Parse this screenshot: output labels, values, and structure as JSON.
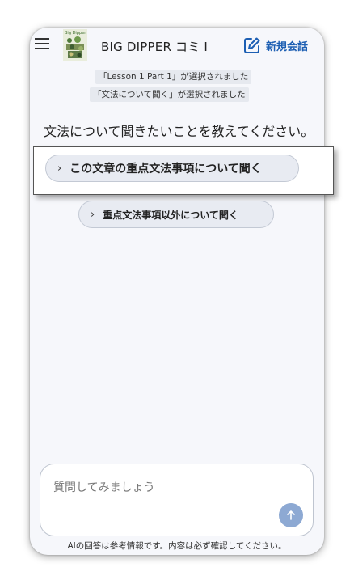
{
  "header": {
    "title": "BIG DIPPER コミ I",
    "new_chat_label": "新規会話",
    "logo_text": "Big Dipper"
  },
  "selections": [
    "「Lesson 1 Part 1」が選択されました",
    "「文法について聞く」が選択されました"
  ],
  "prompt_text": "文法について聞きたいことを教えてください。",
  "options": [
    {
      "label": "この文章の重点文法事項について聞く"
    },
    {
      "label": "重点文法事項以外について聞く"
    }
  ],
  "input": {
    "placeholder": "質問してみましょう"
  },
  "disclaimer": "AIの回答は参考情報です。内容は必ず確認してください。",
  "colors": {
    "accent": "#1d5fb3",
    "send_button": "#8da9d3",
    "background": "#f6f7fb"
  },
  "icons": [
    "menu-icon",
    "book-cover-logo",
    "edit-icon",
    "chevron-right-icon",
    "arrow-up-icon"
  ]
}
